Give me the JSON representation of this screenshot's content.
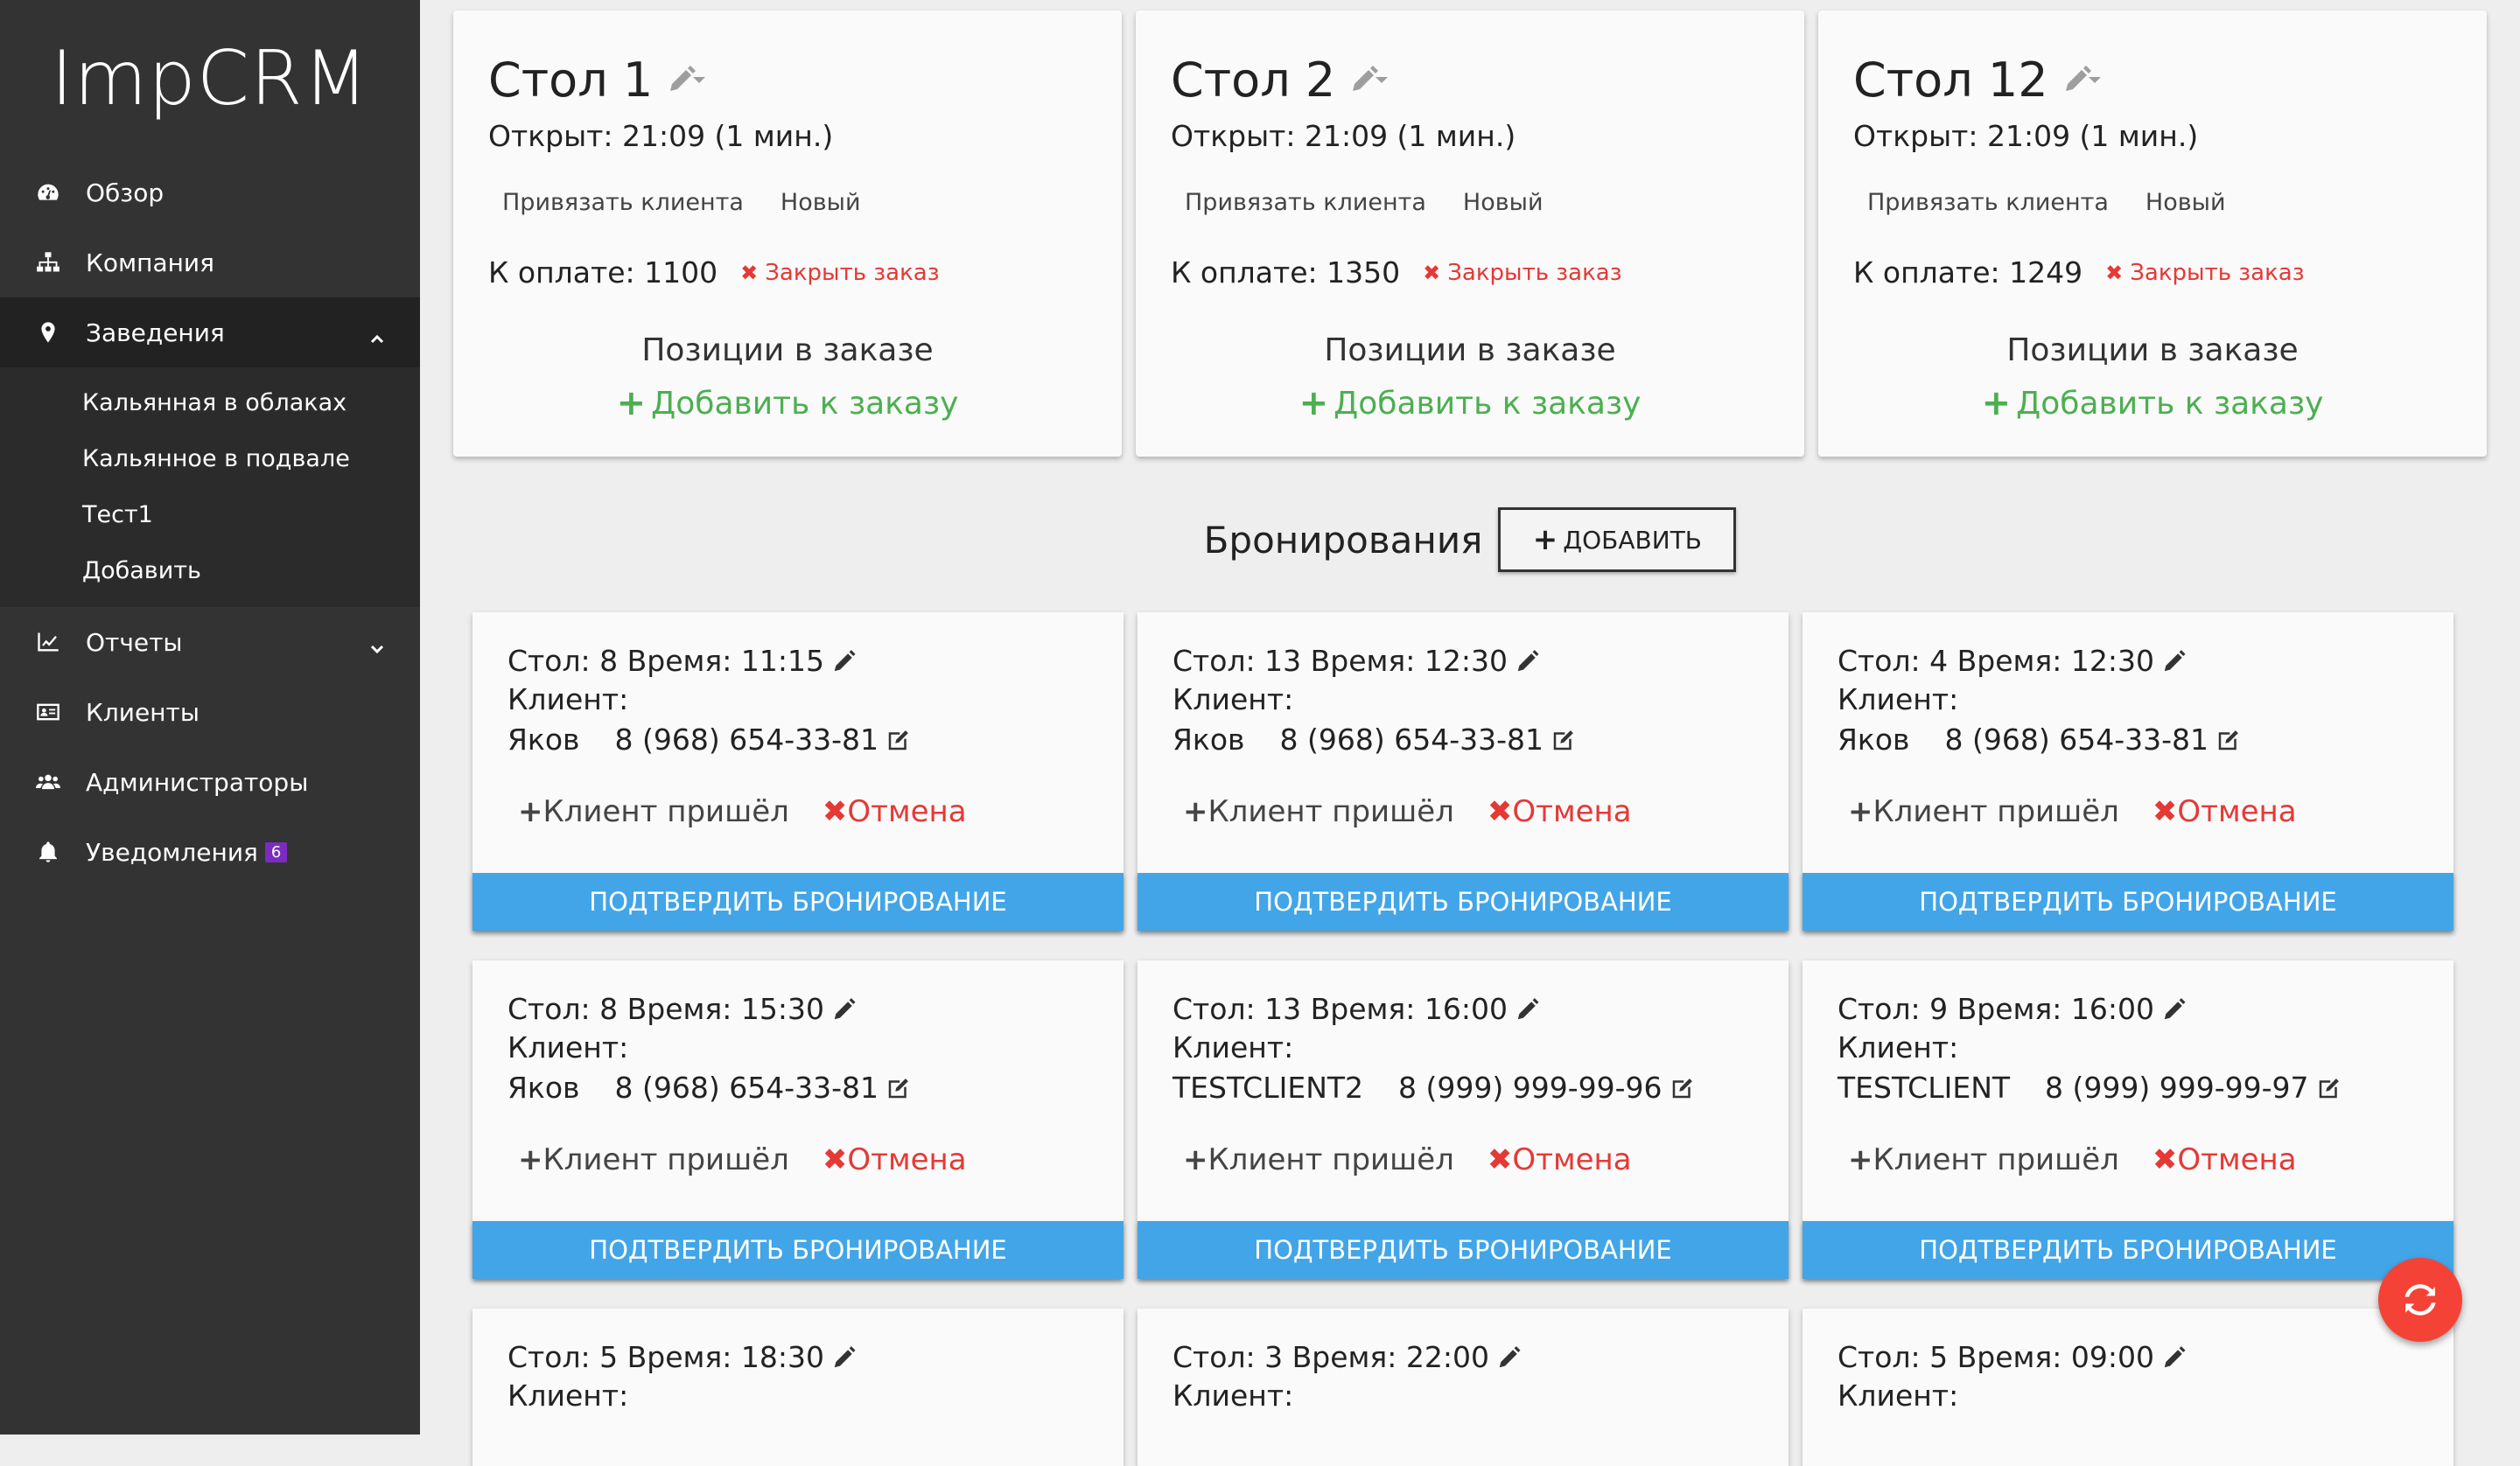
{
  "brand": "ImpCRM",
  "sidebar": {
    "items": [
      {
        "label": "Обзор",
        "icon": "dashboard-icon"
      },
      {
        "label": "Компания",
        "icon": "sitemap-icon"
      },
      {
        "label": "Заведения",
        "icon": "map-marker-icon"
      },
      {
        "label": "Отчеты",
        "icon": "line-chart-icon"
      },
      {
        "label": "Клиенты",
        "icon": "id-card-icon"
      },
      {
        "label": "Администраторы",
        "icon": "users-icon"
      },
      {
        "label": "Уведомления",
        "icon": "bell-icon",
        "badge": "6"
      }
    ],
    "sub_items": [
      "Кальянная в облаках",
      "Кальянное в подвале",
      "Тест1",
      "Добавить"
    ]
  },
  "tables": [
    {
      "title": "Стол 1",
      "opened": "Открыт: 21:09 (1 мин.)",
      "link_client": "Привязать клиента",
      "link_new": "Новый",
      "to_pay": "К оплате: 1100",
      "close_order": "Закрыть заказ",
      "positions": "Позиции в заказе",
      "add_to_order": "Добавить к заказу"
    },
    {
      "title": "Стол 2",
      "opened": "Открыт: 21:09 (1 мин.)",
      "link_client": "Привязать клиента",
      "link_new": "Новый",
      "to_pay": "К оплате: 1350",
      "close_order": "Закрыть заказ",
      "positions": "Позиции в заказе",
      "add_to_order": "Добавить к заказу"
    },
    {
      "title": "Стол 12",
      "opened": "Открыт: 21:09 (1 мин.)",
      "link_client": "Привязать клиента",
      "link_new": "Новый",
      "to_pay": "К оплате: 1249",
      "close_order": "Закрыть заказ",
      "positions": "Позиции в заказе",
      "add_to_order": "Добавить к заказу"
    }
  ],
  "bookings_header": {
    "title": "Бронирования",
    "add_label": "ДОБАВИТЬ"
  },
  "booking_labels": {
    "client": "Клиент:",
    "came": "Клиент пришёл",
    "cancel": "Отмена",
    "confirm": "ПОДТВЕРДИТЬ БРОНИРОВАНИЕ"
  },
  "bookings": [
    {
      "table_time": "Стол: 8 Время: 11:15",
      "name": "Яков",
      "phone": "8 (968) 654-33-81"
    },
    {
      "table_time": "Стол: 13 Время: 12:30",
      "name": "Яков",
      "phone": "8 (968) 654-33-81"
    },
    {
      "table_time": "Стол: 4 Время: 12:30",
      "name": "Яков",
      "phone": "8 (968) 654-33-81"
    },
    {
      "table_time": "Стол: 8 Время: 15:30",
      "name": "Яков",
      "phone": "8 (968) 654-33-81"
    },
    {
      "table_time": "Стол: 13 Время: 16:00",
      "name": "TESTCLIENT2",
      "phone": "8 (999) 999-99-96"
    },
    {
      "table_time": "Стол: 9 Время: 16:00",
      "name": "TESTCLIENT",
      "phone": "8 (999) 999-99-97"
    },
    {
      "table_time": "Стол: 5 Время: 18:30"
    },
    {
      "table_time": "Стол: 3 Время: 22:00"
    },
    {
      "table_time": "Стол: 5 Время: 09:00"
    }
  ],
  "colors": {
    "sidebar": "#333333",
    "confirm": "#42a5e8",
    "cancel": "#e53935",
    "add": "#4caf50",
    "fab": "#f44336",
    "badge": "#7b2cbf"
  }
}
